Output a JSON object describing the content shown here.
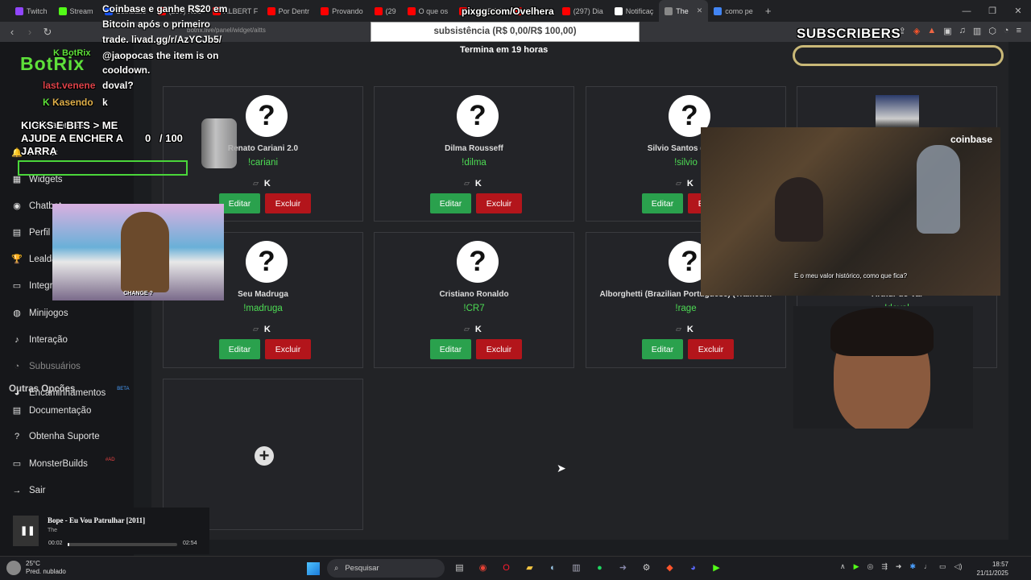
{
  "browser": {
    "tabs": [
      {
        "label": "Twitch",
        "color": "#9146ff"
      },
      {
        "label": "Stream",
        "color": "#53fc18"
      },
      {
        "label": "Coinbase",
        "color": "#1652f0"
      },
      {
        "label": "(297) Rod",
        "color": "#ff0000"
      },
      {
        "label": "ALBERT F",
        "color": "#ff0000"
      },
      {
        "label": "Por Dentr",
        "color": "#ff0000"
      },
      {
        "label": "Provando",
        "color": "#ff0000"
      },
      {
        "label": "(29",
        "color": "#ff0000"
      },
      {
        "label": "O que os",
        "color": "#ff0000"
      },
      {
        "label": "ICEBERG",
        "color": "#ff0000"
      },
      {
        "label": "Idiots In",
        "color": "#ff0000"
      },
      {
        "label": "(297) Dia",
        "color": "#ff0000"
      },
      {
        "label": "Notificaç",
        "color": "#ffffff"
      },
      {
        "label": "The",
        "color": "#888888",
        "active": true
      },
      {
        "label": "como pe",
        "color": "#4285f4"
      }
    ],
    "url": "botrix.live/panel/widget/aitts"
  },
  "overlay": {
    "coinbase_promo": "Coinbase e ganhe R$20 em Bitcoin após o primeiro trade. livad.gg/r/AzYCJb5/",
    "pix_link": "pixgg.com/Ovelhera",
    "goal_text": "subsistência (R$ 0,00/R$ 100,00)",
    "ends_in": "Termina em 19 horas",
    "subscribers": "SUBSCRIBERS",
    "botrix_label": "BotRix",
    "cooldown_msg": "@jaopocas the item is on cooldown.",
    "last_chatter": "last.venene",
    "chat_user_msg": "doval?",
    "chat_user": "Kasendo",
    "chat_text": "k",
    "jarra_title": "KICKS E BITS > ME AJUDE A ENCHER A JARRA",
    "jarra_count": "0",
    "jarra_total": "/ 100",
    "cartoon_caption": "CHANGE ?",
    "video_logo": "coinbase",
    "video_subtitle": "E o meu valor histórico, como que fica?"
  },
  "sidebar": {
    "logo": "BotRix",
    "items": [
      {
        "label": "Plataformas",
        "icon": "cube-icon",
        "glyph": "▣"
      },
      {
        "label": "Alertas",
        "icon": "bell-icon",
        "glyph": "🔔"
      },
      {
        "label": "Widgets",
        "icon": "grid-icon",
        "glyph": "▦"
      },
      {
        "label": "Chatbot",
        "icon": "robot-icon",
        "glyph": "◉"
      },
      {
        "label": "Perfil",
        "icon": "profile-icon",
        "glyph": "▤"
      },
      {
        "label": "Lealdade",
        "icon": "trophy-icon",
        "glyph": "🏆"
      },
      {
        "label": "Integrações",
        "icon": "monitor-icon",
        "glyph": "▭"
      },
      {
        "label": "Minijogos",
        "icon": "gamepad-icon",
        "glyph": "◍"
      },
      {
        "label": "Interação",
        "icon": "music-icon",
        "glyph": "♪"
      },
      {
        "label": "Subusuários",
        "icon": "users-icon",
        "glyph": "◔"
      },
      {
        "label": "Encaminhamentos",
        "icon": "user-group-icon",
        "glyph": "◕",
        "badge": "BETA"
      }
    ],
    "other_title": "Outras Opções",
    "other_items": [
      {
        "label": "Documentação",
        "icon": "document-icon",
        "glyph": "▤"
      },
      {
        "label": "Obtenha Suporte",
        "icon": "help-icon",
        "glyph": "?"
      },
      {
        "label": "MonsterBuilds",
        "icon": "laptop-icon",
        "glyph": "▭",
        "badge": "#AD"
      },
      {
        "label": "Sair",
        "icon": "logout-icon",
        "glyph": "→"
      }
    ]
  },
  "voices": [
    {
      "name": "Renato Cariani 2.0",
      "command": "!cariani"
    },
    {
      "name": "Dilma Rousseff",
      "command": "!dilma"
    },
    {
      "name": "Silvio Santos (Show",
      "command": "!silvio"
    },
    {
      "name": "",
      "command": ""
    },
    {
      "name": "Seu Madruga",
      "command": "!madruga"
    },
    {
      "name": "Cristiano Ronaldo",
      "command": "!CR7"
    },
    {
      "name": "Alborghetti (Brazilian Portuguese) (Trained…",
      "command": "!rage"
    },
    {
      "name": "Arthur do Val",
      "command": "!doval"
    }
  ],
  "buttons": {
    "edit": "Editar",
    "delete": "Excluir"
  },
  "player": {
    "title": "Bope - Eu Vou Patrulhar [2011]",
    "artist": "The",
    "current": "00:02",
    "total": "02:54",
    "progress": 0.012
  },
  "taskbar": {
    "temp": "25°C",
    "weather": "Pred. nublado",
    "search_placeholder": "Pesquisar",
    "time": "18:57",
    "date": "21/11/2025"
  }
}
